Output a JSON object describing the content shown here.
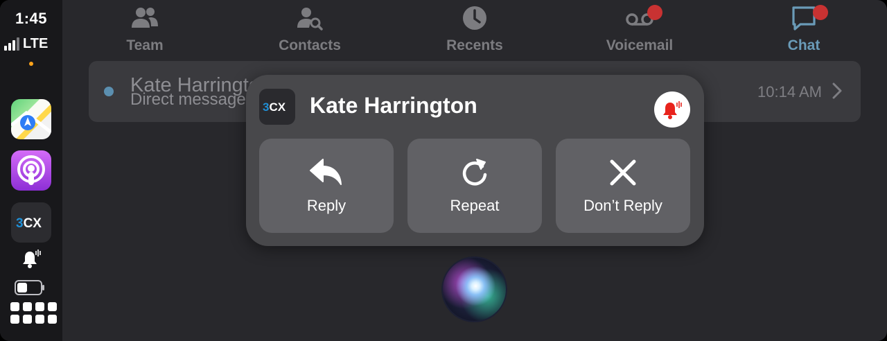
{
  "status": {
    "time": "1:45",
    "network": "LTE"
  },
  "dock": {
    "apps": [
      {
        "name": "Maps",
        "icon": "maps-icon"
      },
      {
        "name": "Podcasts",
        "icon": "podcasts-icon"
      },
      {
        "name": "3CX",
        "icon": "threecx-icon"
      }
    ],
    "threecx_logo": "3CX"
  },
  "tabs": [
    {
      "label": "Team",
      "icon": "people-icon",
      "active": false,
      "badge": false
    },
    {
      "label": "Contacts",
      "icon": "contact-search-icon",
      "active": false,
      "badge": false
    },
    {
      "label": "Recents",
      "icon": "clock-icon",
      "active": false,
      "badge": false
    },
    {
      "label": "Voicemail",
      "icon": "voicemail-icon",
      "active": false,
      "badge": true
    },
    {
      "label": "Chat",
      "icon": "chat-icon",
      "active": true,
      "badge": true
    }
  ],
  "message_row": {
    "name": "Kate Harrington",
    "subtitle": "Direct message",
    "time": "10:14 AM",
    "unread": true
  },
  "notification": {
    "app_logo": "3CX",
    "title": "Kate Harrington",
    "actions": [
      {
        "label": "Reply",
        "icon": "reply-icon"
      },
      {
        "label": "Repeat",
        "icon": "repeat-icon"
      },
      {
        "label": "Don’t Reply",
        "icon": "close-icon"
      }
    ]
  },
  "colors": {
    "accent": "#6a9bb8",
    "badge_red": "#c83232",
    "alert_red": "#e8231c",
    "card_bg": "#48484b",
    "button_bg": "#616165"
  }
}
